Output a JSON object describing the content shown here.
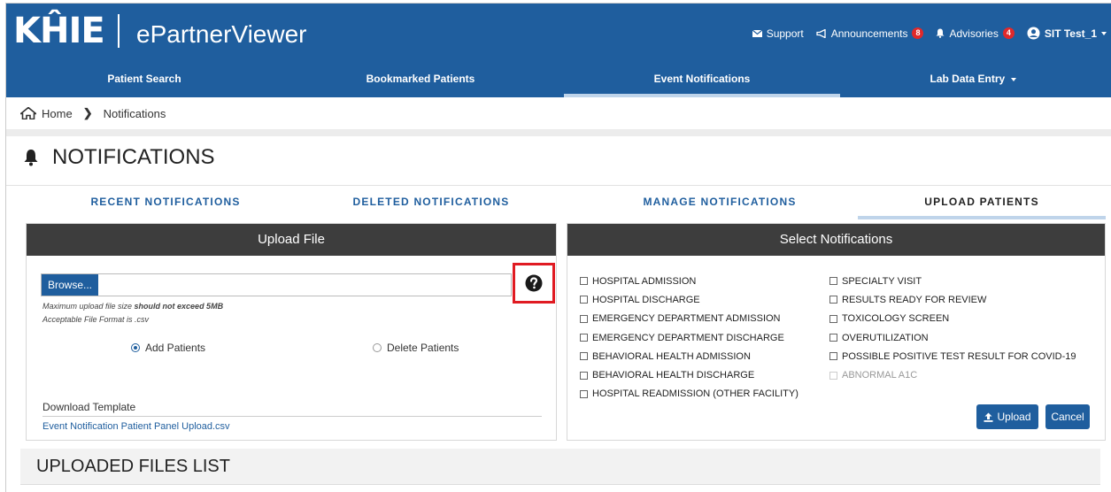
{
  "header": {
    "logo": "KĤIE",
    "app_title": "ePartnerViewer",
    "support": "Support",
    "announcements": "Announcements",
    "announcements_count": "8",
    "advisories": "Advisories",
    "advisories_count": "4",
    "user": "SIT Test_1"
  },
  "nav": {
    "items": [
      "Patient Search",
      "Bookmarked Patients",
      "Event Notifications",
      "Lab Data Entry"
    ],
    "active": "Event Notifications"
  },
  "breadcrumb": {
    "home": "Home",
    "current": "Notifications"
  },
  "page": {
    "title": "NOTIFICATIONS"
  },
  "tabs": {
    "items": [
      "RECENT NOTIFICATIONS",
      "DELETED NOTIFICATIONS",
      "MANAGE NOTIFICATIONS",
      "UPLOAD PATIENTS"
    ],
    "active": "UPLOAD PATIENTS"
  },
  "upload": {
    "title": "Upload File",
    "browse": "Browse...",
    "size_note_prefix": "Maximum upload file size ",
    "size_note_bold": "should not exceed 5MB",
    "format_note": "Acceptable File Format is .csv",
    "add_label": "Add Patients",
    "delete_label": "Delete Patients",
    "selected_option": "Add Patients",
    "download_title": "Download Template",
    "download_link": "Event Notification Patient Panel Upload.csv"
  },
  "select": {
    "title": "Select Notifications",
    "left": [
      "HOSPITAL ADMISSION",
      "HOSPITAL DISCHARGE",
      "EMERGENCY DEPARTMENT ADMISSION",
      "EMERGENCY DEPARTMENT DISCHARGE",
      "BEHAVIORAL HEALTH ADMISSION",
      "BEHAVIORAL HEALTH DISCHARGE",
      "HOSPITAL READMISSION (OTHER FACILITY)"
    ],
    "right": [
      "SPECIALTY VISIT",
      "RESULTS READY FOR REVIEW",
      "TOXICOLOGY SCREEN",
      "OVERUTILIZATION",
      "POSSIBLE POSITIVE TEST RESULT FOR COVID-19",
      "ABNORMAL A1C"
    ],
    "upload_btn": "Upload",
    "cancel_btn": "Cancel"
  },
  "uploaded_files": {
    "title": "UPLOADED FILES LIST"
  },
  "colors": {
    "primary": "#1f5e9e",
    "panel_header": "#3d3d3d",
    "highlight": "#e01b22",
    "badge": "#e0292b"
  }
}
